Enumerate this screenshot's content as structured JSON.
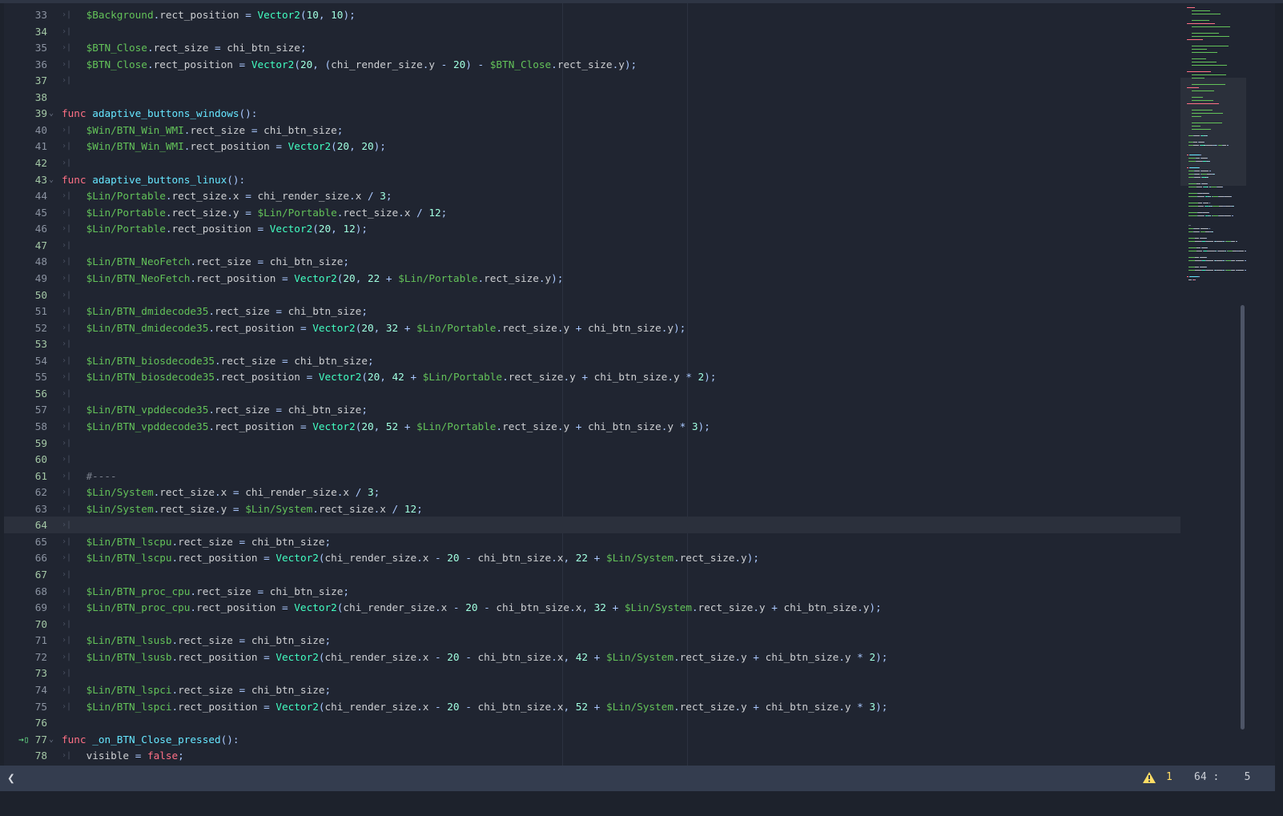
{
  "editor": {
    "current_line": 64,
    "first_line": 33,
    "lines": [
      "\t$Background.rect_position = Vector2(10, 10);",
      "\t",
      "\t$BTN_Close.rect_size = chi_btn_size;",
      "\t$BTN_Close.rect_position = Vector2(20, (chi_render_size.y - 20) - $BTN_Close.rect_size.y);",
      "\t",
      "",
      "func adaptive_buttons_windows():",
      "\t$Win/BTN_Win_WMI.rect_size = chi_btn_size;",
      "\t$Win/BTN_Win_WMI.rect_position = Vector2(20, 20);",
      "\t",
      "func adaptive_buttons_linux():",
      "\t$Lin/Portable.rect_size.x = chi_render_size.x / 3;",
      "\t$Lin/Portable.rect_size.y = $Lin/Portable.rect_size.x / 12;",
      "\t$Lin/Portable.rect_position = Vector2(20, 12);",
      "\t",
      "\t$Lin/BTN_NeoFetch.rect_size = chi_btn_size;",
      "\t$Lin/BTN_NeoFetch.rect_position = Vector2(20, 22 + $Lin/Portable.rect_size.y);",
      "\t",
      "\t$Lin/BTN_dmidecode35.rect_size = chi_btn_size;",
      "\t$Lin/BTN_dmidecode35.rect_position = Vector2(20, 32 + $Lin/Portable.rect_size.y + chi_btn_size.y);",
      "\t",
      "\t$Lin/BTN_biosdecode35.rect_size = chi_btn_size;",
      "\t$Lin/BTN_biosdecode35.rect_position = Vector2(20, 42 + $Lin/Portable.rect_size.y + chi_btn_size.y * 2);",
      "\t",
      "\t$Lin/BTN_vpddecode35.rect_size = chi_btn_size;",
      "\t$Lin/BTN_vpddecode35.rect_position = Vector2(20, 52 + $Lin/Portable.rect_size.y + chi_btn_size.y * 3);",
      "\t",
      "\t",
      "\t#----",
      "\t$Lin/System.rect_size.x = chi_render_size.x / 3;",
      "\t$Lin/System.rect_size.y = $Lin/System.rect_size.x / 12;",
      "\t",
      "\t$Lin/BTN_lscpu.rect_size = chi_btn_size;",
      "\t$Lin/BTN_lscpu.rect_position = Vector2(chi_render_size.x - 20 - chi_btn_size.x, 22 + $Lin/System.rect_size.y);",
      "\t",
      "\t$Lin/BTN_proc_cpu.rect_size = chi_btn_size;",
      "\t$Lin/BTN_proc_cpu.rect_position = Vector2(chi_render_size.x - 20 - chi_btn_size.x, 32 + $Lin/System.rect_size.y + chi_btn_size.y);",
      "\t",
      "\t$Lin/BTN_lsusb.rect_size = chi_btn_size;",
      "\t$Lin/BTN_lsusb.rect_position = Vector2(chi_render_size.x - 20 - chi_btn_size.x, 42 + $Lin/System.rect_size.y + chi_btn_size.y * 2);",
      "\t",
      "\t$Lin/BTN_lspci.rect_size = chi_btn_size;",
      "\t$Lin/BTN_lspci.rect_position = Vector2(chi_render_size.x - 20 - chi_btn_size.x, 52 + $Lin/System.rect_size.y + chi_btn_size.y * 3);",
      "",
      "func _on_BTN_Close_pressed():",
      "\tvisible = false;"
    ],
    "signal_connected_lines": [
      77
    ]
  },
  "statusbar": {
    "warning_count": "1",
    "line": "64",
    "column": "5",
    "line_col_text": "64 :    5"
  },
  "colors": {
    "background": "#202531",
    "keyword": "#ff7085",
    "node_path": "#63c259",
    "class": "#42ffc2",
    "number": "#a1ffe0",
    "function": "#66e6ff",
    "warning": "#ffdd65"
  }
}
